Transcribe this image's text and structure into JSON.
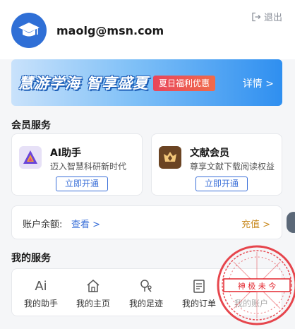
{
  "header": {
    "email": "maolg@msn.com",
    "logout_label": "退出"
  },
  "banner": {
    "title": "慧游学海 智享盛夏",
    "tag": "夏日福利优惠",
    "more": "详情 >"
  },
  "vip": {
    "section_title": "会员服务",
    "cards": [
      {
        "name": "AI助手",
        "desc": "迈入智慧科研新时代",
        "button": "立即开通"
      },
      {
        "name": "文献会员",
        "desc": "尊享文献下载阅读权益",
        "button": "立即开通"
      }
    ]
  },
  "balance": {
    "label": "账户余额:",
    "view": "查看 >",
    "recharge": "充值 >"
  },
  "services": {
    "section_title": "我的服务",
    "items": [
      {
        "label": "我的助手",
        "icon": "ai-icon"
      },
      {
        "label": "我的主页",
        "icon": "home-icon"
      },
      {
        "label": "我的足迹",
        "icon": "footprint-icon"
      },
      {
        "label": "我的订单",
        "icon": "order-icon"
      },
      {
        "label": "我的账户",
        "icon": "account-icon"
      }
    ]
  },
  "stamp": {
    "text": "神 极 未 今"
  },
  "colors": {
    "accent": "#3a6fd8",
    "recharge": "#c98b22",
    "banner_tag": "#e8455b",
    "stamp": "#e3262e"
  }
}
